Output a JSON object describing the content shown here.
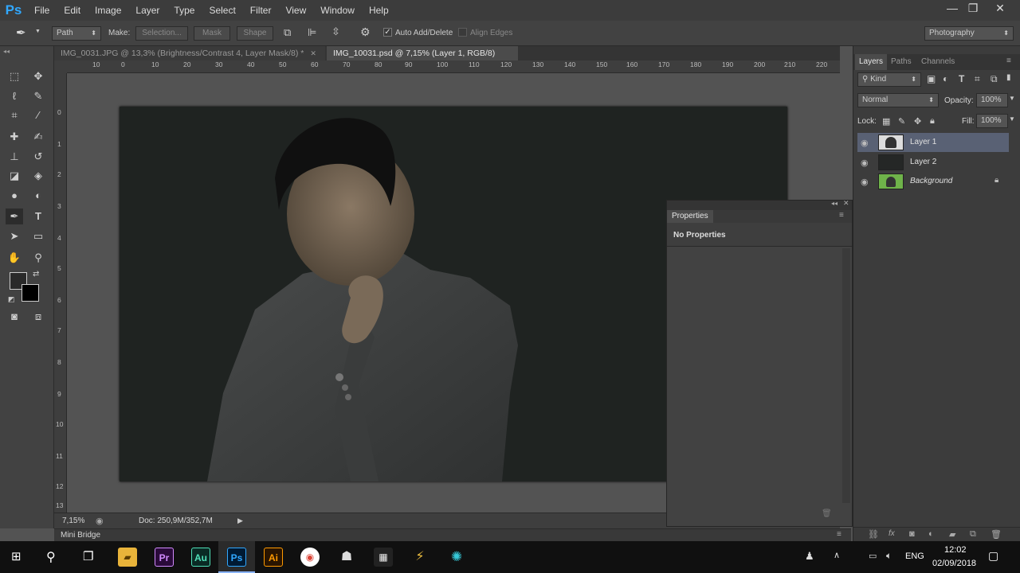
{
  "app": {
    "logo": "Ps"
  },
  "menu": {
    "items": [
      "File",
      "Edit",
      "Image",
      "Layer",
      "Type",
      "Select",
      "Filter",
      "View",
      "Window",
      "Help"
    ]
  },
  "window_controls": {
    "minimize": "—",
    "restore": "❐",
    "close": "✕"
  },
  "options_bar": {
    "tool_mode": "Path",
    "make_label": "Make:",
    "selection_btn": "Selection...",
    "mask_btn": "Mask",
    "shape_btn": "Shape",
    "auto_add_delete": "Auto Add/Delete",
    "align_edges": "Align Edges",
    "workspace": "Photography"
  },
  "doc_tabs": [
    {
      "title": "IMG_0031.JPG @ 13,3% (Brightness/Contrast 4, Layer Mask/8) *"
    },
    {
      "title": "IMG_10031.psd @ 7,15% (Layer 1, RGB/8) *"
    }
  ],
  "ruler_top": [
    "10",
    "0",
    "10",
    "20",
    "30",
    "40",
    "50",
    "60",
    "70",
    "80",
    "90",
    "100",
    "110",
    "120",
    "130",
    "140",
    "150",
    "160",
    "170",
    "180",
    "190",
    "200",
    "210",
    "220"
  ],
  "ruler_left": [
    "0",
    "1",
    "2",
    "3",
    "4",
    "5",
    "6",
    "7",
    "8",
    "9",
    "10",
    "11",
    "12",
    "13"
  ],
  "status": {
    "zoom": "7,15%",
    "doc": "Doc: 250,9M/352,7M"
  },
  "mini_bridge": "Mini Bridge",
  "layers_panel": {
    "tabs": [
      "Layers",
      "Paths",
      "Channels"
    ],
    "kind": "Kind",
    "blend_mode": "Normal",
    "opacity_label": "Opacity:",
    "opacity": "100%",
    "lock_label": "Lock:",
    "fill_label": "Fill:",
    "fill": "100%",
    "layers": [
      {
        "name": "Layer 1",
        "selected": true
      },
      {
        "name": "Layer 2",
        "selected": false
      },
      {
        "name": "Background",
        "selected": false
      }
    ]
  },
  "properties_panel": {
    "title": "Properties",
    "message": "No Properties"
  },
  "taskbar": {
    "apps": [
      "Pr",
      "Au",
      "Ps",
      "Ai"
    ],
    "lang": "ENG",
    "time": "12:02",
    "date": "02/09/2018"
  },
  "colors": {
    "accent": "#31a8ff",
    "selected_layer": "#596174"
  }
}
